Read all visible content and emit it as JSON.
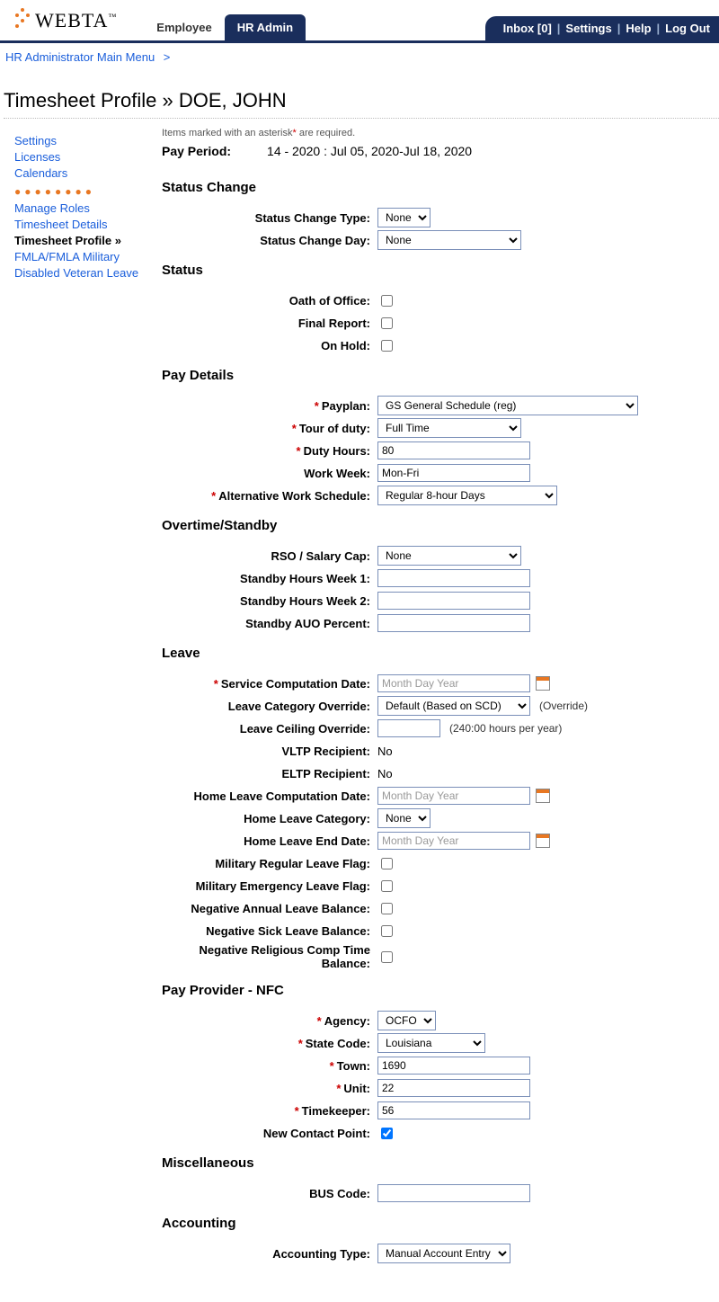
{
  "logo": {
    "brand": "WEBTA",
    "tm": "™"
  },
  "tabs": {
    "employee": "Employee",
    "hr_admin": "HR Admin"
  },
  "util": {
    "inbox": "Inbox [0]",
    "settings": "Settings",
    "help": "Help",
    "logout": "Log Out"
  },
  "breadcrumb": {
    "main_menu": "HR Administrator Main Menu",
    "gt": ">"
  },
  "page_title": "Timesheet Profile » DOE, JOHN",
  "sidebar": {
    "settings": "Settings",
    "licenses": "Licenses",
    "calendars": "Calendars",
    "manage_roles": "Manage Roles",
    "timesheet_details": "Timesheet Details",
    "timesheet_profile": "Timesheet Profile »",
    "fmla": "FMLA/FMLA Military",
    "disabled_veteran": "Disabled Veteran Leave"
  },
  "notes": {
    "required": "Items marked with an asterisk",
    "required2": " are required."
  },
  "pay_period": {
    "label": "Pay Period:",
    "value": "14 - 2020 : Jul 05, 2020-Jul 18, 2020"
  },
  "sections": {
    "status_change": "Status Change",
    "status": "Status",
    "pay_details": "Pay Details",
    "overtime": "Overtime/Standby",
    "leave": "Leave",
    "pay_provider": "Pay Provider - NFC",
    "misc": "Miscellaneous",
    "accounting": "Accounting"
  },
  "fields": {
    "status_change_type": {
      "label": "Status Change Type:",
      "value": "None"
    },
    "status_change_day": {
      "label": "Status Change Day:",
      "value": "None"
    },
    "oath_of_office": {
      "label": "Oath of Office:"
    },
    "final_report": {
      "label": "Final Report:"
    },
    "on_hold": {
      "label": "On Hold:"
    },
    "payplan": {
      "label": "Payplan:",
      "value": "GS General Schedule (reg)"
    },
    "tour_of_duty": {
      "label": "Tour of duty:",
      "value": "Full Time"
    },
    "duty_hours": {
      "label": "Duty Hours:",
      "value": "80"
    },
    "work_week": {
      "label": "Work Week:",
      "value": "Mon-Fri"
    },
    "aws": {
      "label": "Alternative Work Schedule:",
      "value": "Regular 8-hour Days"
    },
    "rso": {
      "label": "RSO / Salary Cap:",
      "value": "None"
    },
    "standby_w1": {
      "label": "Standby Hours Week 1:",
      "value": ""
    },
    "standby_w2": {
      "label": "Standby Hours Week 2:",
      "value": ""
    },
    "standby_auo": {
      "label": "Standby AUO Percent:",
      "value": ""
    },
    "scd": {
      "label": "Service Computation Date:",
      "placeholder": "Month Day Year"
    },
    "lco": {
      "label": "Leave Category Override:",
      "value": "Default (Based on SCD)",
      "hint": "(Override)"
    },
    "lceiling": {
      "label": "Leave Ceiling Override:",
      "value": "",
      "hint": "(240:00 hours per year)"
    },
    "vltp": {
      "label": "VLTP Recipient:",
      "value": "No"
    },
    "eltp": {
      "label": "ELTP Recipient:",
      "value": "No"
    },
    "hlcd": {
      "label": "Home Leave Computation Date:",
      "placeholder": "Month Day Year"
    },
    "hlc": {
      "label": "Home Leave Category:",
      "value": "None"
    },
    "hled": {
      "label": "Home Leave End Date:",
      "placeholder": "Month Day Year"
    },
    "mil_reg": {
      "label": "Military Regular Leave Flag:"
    },
    "mil_emerg": {
      "label": "Military Emergency Leave Flag:"
    },
    "neg_annual": {
      "label": "Negative Annual Leave Balance:"
    },
    "neg_sick": {
      "label": "Negative Sick Leave Balance:"
    },
    "neg_relig": {
      "label": "Negative Religious Comp Time Balance:"
    },
    "agency": {
      "label": "Agency:",
      "value": "OCFO"
    },
    "state_code": {
      "label": "State Code:",
      "value": "Louisiana"
    },
    "town": {
      "label": "Town:",
      "value": "1690"
    },
    "unit": {
      "label": "Unit:",
      "value": "22"
    },
    "timekeeper": {
      "label": "Timekeeper:",
      "value": "56"
    },
    "new_contact": {
      "label": "New Contact Point:"
    },
    "bus_code": {
      "label": "BUS Code:",
      "value": ""
    },
    "accounting_type": {
      "label": "Accounting Type:",
      "value": "Manual Account Entry"
    }
  }
}
